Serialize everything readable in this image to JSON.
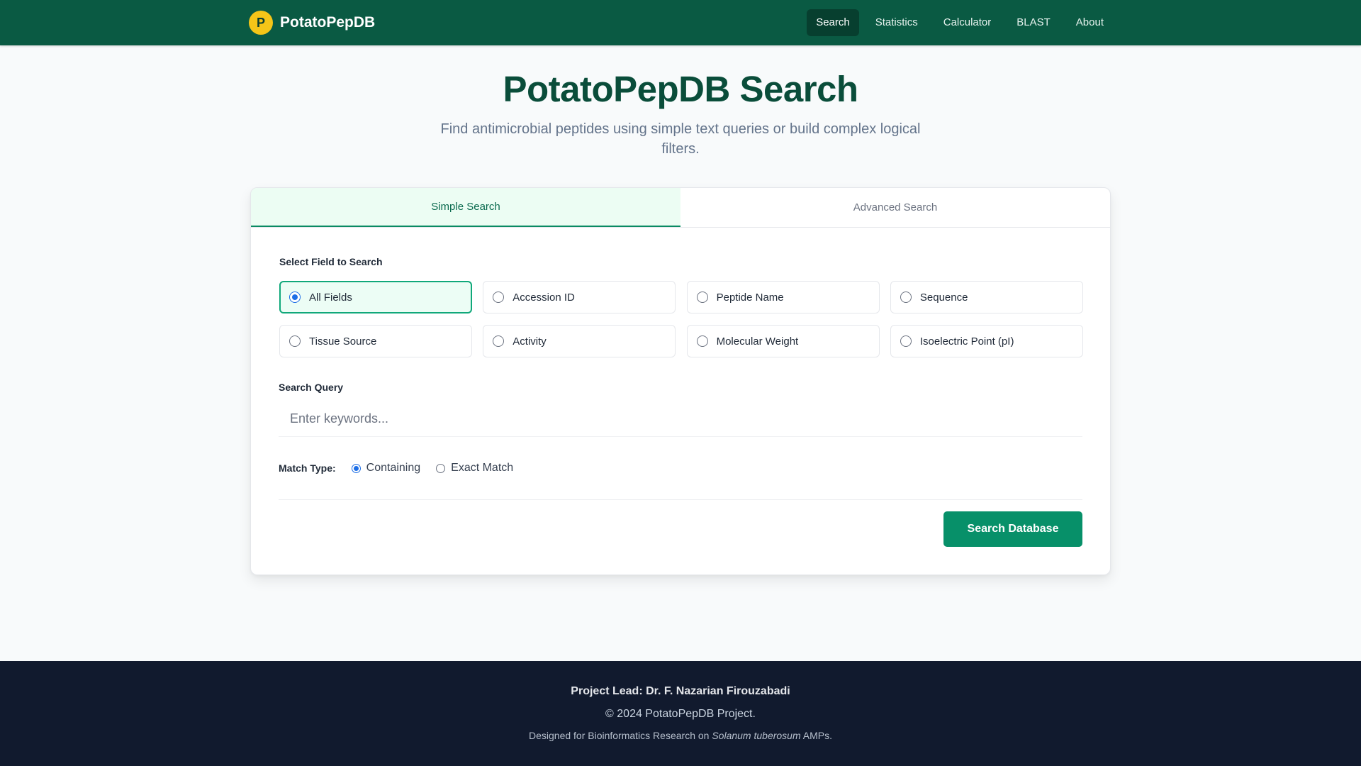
{
  "header": {
    "logo_letter": "P",
    "brand_name": "PotatoPepDB",
    "nav": [
      {
        "label": "Search",
        "active": true
      },
      {
        "label": "Statistics",
        "active": false
      },
      {
        "label": "Calculator",
        "active": false
      },
      {
        "label": "BLAST",
        "active": false
      },
      {
        "label": "About",
        "active": false
      }
    ]
  },
  "hero": {
    "title": "PotatoPepDB Search",
    "subtitle": "Find antimicrobial peptides using simple text queries or build complex logical filters."
  },
  "tabs": [
    {
      "label": "Simple Search",
      "active": true
    },
    {
      "label": "Advanced Search",
      "active": false
    }
  ],
  "field_section": {
    "label": "Select Field to Search",
    "options": [
      {
        "label": "All Fields",
        "selected": true
      },
      {
        "label": "Accession ID",
        "selected": false
      },
      {
        "label": "Peptide Name",
        "selected": false
      },
      {
        "label": "Sequence",
        "selected": false
      },
      {
        "label": "Tissue Source",
        "selected": false
      },
      {
        "label": "Activity",
        "selected": false
      },
      {
        "label": "Molecular Weight",
        "selected": false
      },
      {
        "label": "Isoelectric Point (pI)",
        "selected": false
      }
    ]
  },
  "query": {
    "label": "Search Query",
    "placeholder": "Enter keywords...",
    "value": ""
  },
  "match_type": {
    "label": "Match Type:",
    "options": [
      {
        "label": "Containing",
        "selected": true
      },
      {
        "label": "Exact Match",
        "selected": false
      }
    ]
  },
  "search_button_label": "Search Database",
  "footer": {
    "lead": "Project Lead: Dr. F. Nazarian Firouzabadi",
    "copyright": "© 2024 PotatoPepDB Project.",
    "note_prefix": "Designed for Bioinformatics Research on",
    "note_species": "Solanum tuberosum",
    "note_suffix": "AMPs."
  },
  "colors": {
    "header_bg": "#0a5a43",
    "accent": "#079069",
    "logo_bg": "#f5c518",
    "title": "#0a4d3a",
    "footer_bg": "#111a2e",
    "radio_checked": "#1d6ee6"
  }
}
